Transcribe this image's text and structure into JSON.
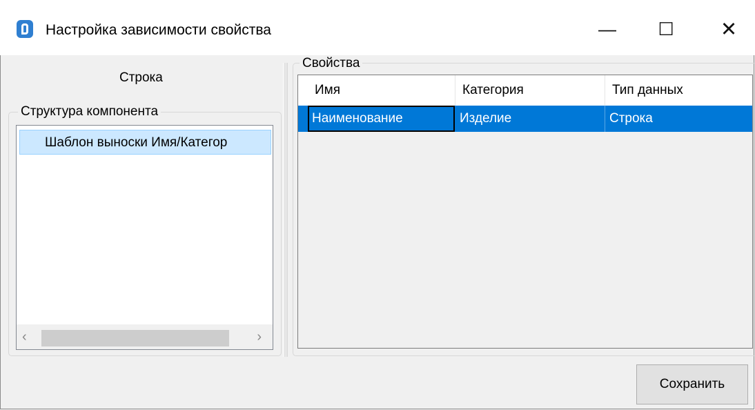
{
  "window": {
    "title": "Настройка зависимости свойства",
    "controls": {
      "minimize": "—",
      "maximize": "☐",
      "close": "✕"
    }
  },
  "left": {
    "type_label": "Строка",
    "group_title": "Структура компонента",
    "tree_items": [
      "Шаблон выноски Имя/Категор"
    ],
    "scrollbar": {
      "left_arrow": "‹",
      "right_arrow": "›"
    }
  },
  "right": {
    "group_title": "Свойства",
    "columns": [
      "Имя",
      "Категория",
      "Тип данных"
    ],
    "rows": [
      [
        "Наименование",
        "Изделие",
        "Строка"
      ]
    ]
  },
  "buttons": {
    "save": "Сохранить"
  },
  "colors": {
    "selection": "#0078d7",
    "tree_selection": "#cce8ff"
  }
}
